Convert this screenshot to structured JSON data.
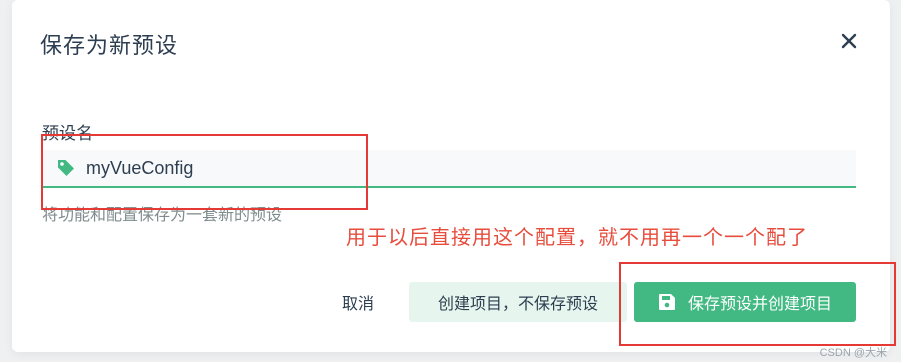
{
  "dialog": {
    "title": "保存为新预设",
    "close_icon": "close-icon"
  },
  "field": {
    "label": "预设名",
    "value": "myVueConfig",
    "icon": "tag-icon",
    "hint": "将功能和配置保存为一套新的预设"
  },
  "annotation": {
    "text": "用于以后直接用这个配置，就不用再一个一个配了",
    "color": "#e74c3c"
  },
  "actions": {
    "cancel_label": "取消",
    "secondary_label": "创建项目，不保存预设",
    "primary_label": "保存预设并创建项目",
    "primary_icon": "save-icon"
  },
  "colors": {
    "accent": "#42b983",
    "secondary_bg": "#e6f6ee",
    "highlight_box": "#e53935"
  },
  "watermark": "CSDN @大米"
}
